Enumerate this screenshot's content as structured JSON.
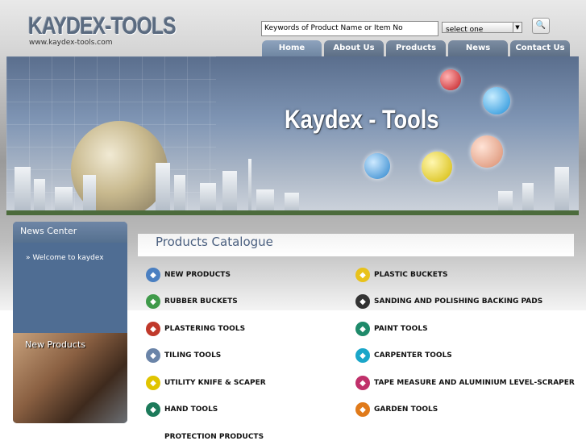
{
  "header": {
    "logo_text": "KAYDEX-TOOLS",
    "logo_url": "www.kaydex-tools.com",
    "search_value": "Keywords of Product Name or Item No",
    "select_value": "select one",
    "search_button_icon": "search-icon"
  },
  "nav": [
    {
      "label": "Home"
    },
    {
      "label": "About Us"
    },
    {
      "label": "Products"
    },
    {
      "label": "News"
    },
    {
      "label": "Contact Us"
    }
  ],
  "banner": {
    "title": "Kaydex - Tools"
  },
  "sidebar": {
    "news_title": "News Center",
    "news_items": [
      {
        "label": "»  Welcome to kaydex"
      }
    ],
    "new_products_label": "New Products"
  },
  "catalogue": {
    "title": "Products Catalogue",
    "items": [
      {
        "label": "NEW PRODUCTS",
        "color": "#4a7fc1"
      },
      {
        "label": "PLASTIC BUCKETS",
        "color": "#e8c21b"
      },
      {
        "label": "RUBBER BUCKETS",
        "color": "#3f9a4a"
      },
      {
        "label": "SANDING AND POLISHING BACKING PADS",
        "color": "#333333"
      },
      {
        "label": "PLASTERING TOOLS",
        "color": "#c0392b"
      },
      {
        "label": "PAINT TOOLS",
        "color": "#1e8a6a"
      },
      {
        "label": "TILING TOOLS",
        "color": "#6a84a8"
      },
      {
        "label": "CARPENTER TOOLS",
        "color": "#1aa6c9"
      },
      {
        "label": "UTILITY KNIFE & SCAPER",
        "color": "#e0c400"
      },
      {
        "label": "TAPE MEASURE AND ALUMINIUM LEVEL-SCRAPER",
        "color": "#c0306a"
      },
      {
        "label": "HAND TOOLS",
        "color": "#1c7a5a"
      },
      {
        "label": "GARDEN TOOLS",
        "color": "#e07a1a"
      },
      {
        "label": "PROTECTION PRODUCTS",
        "color": ""
      }
    ]
  }
}
